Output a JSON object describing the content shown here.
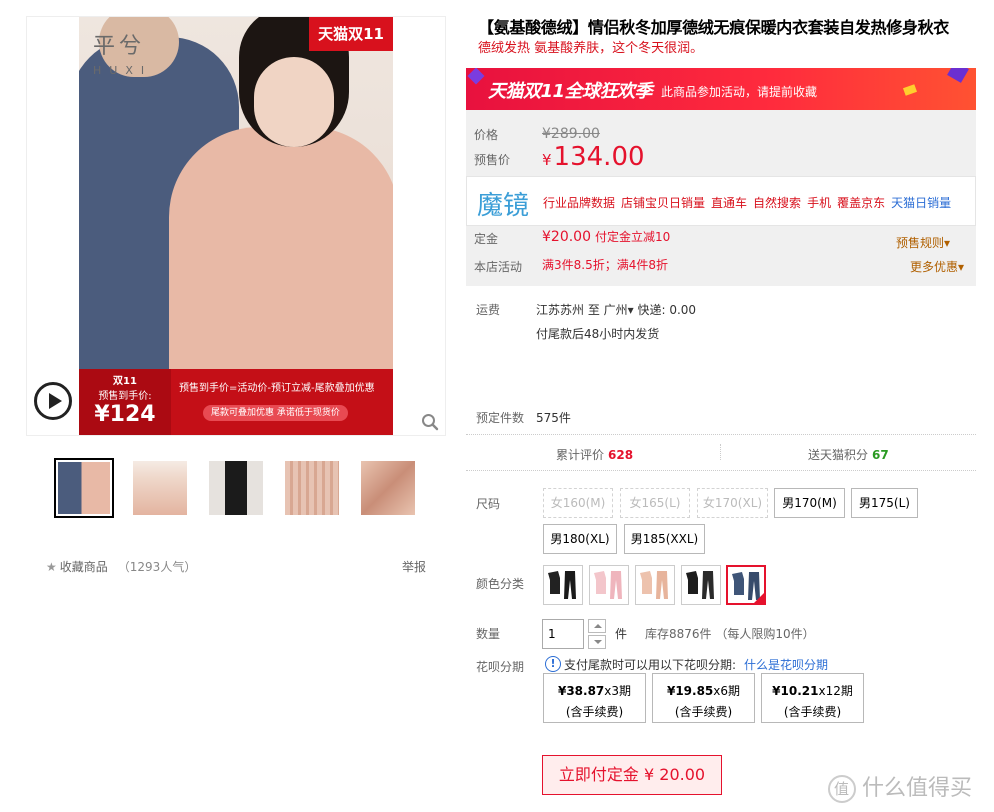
{
  "gallery": {
    "brand_logo": "平兮",
    "brand_logo_sub": "HUXI",
    "tmall_badge": "天猫双11",
    "promo": {
      "tag": "双11",
      "tag_sub": "预售到手价:",
      "price": "¥124",
      "text": "预售到手价=活动价-预订立减-尾款叠加优惠",
      "pill": "尾款可叠加优惠 承诺低于现货价"
    },
    "play_icon": "play-icon",
    "zoom_icon": "magnifier-icon",
    "thumbnails": [
      {
        "id": "thumb-1",
        "colors": [
          "#4b5c7d",
          "#e8b9a6"
        ],
        "active": true
      },
      {
        "id": "thumb-2",
        "colors": [
          "#efd8cb",
          "#e3b4a0"
        ],
        "active": false
      },
      {
        "id": "thumb-3",
        "colors": [
          "#e6e2de",
          "#1b1b1b"
        ],
        "active": false
      },
      {
        "id": "thumb-4",
        "colors": [
          "#e7c3b3",
          "#d8a792"
        ],
        "active": false
      },
      {
        "id": "thumb-5",
        "colors": [
          "#e9c4b0",
          "#c98e78"
        ],
        "active": false
      }
    ],
    "fav_label": "收藏商品",
    "fav_count": "（1293人气）",
    "report_label": "举报"
  },
  "product": {
    "title": "【氨基酸德绒】情侣秋冬加厚德绒无痕保暖内衣套装自发热修身秋衣",
    "subtitle": "德绒发热 氨基酸养肤，这个冬天很润。"
  },
  "banner": {
    "main": "天猫双11全球狂欢季",
    "sub": "此商品参加活动，请提前收藏"
  },
  "price_box": {
    "price_label": "价格",
    "orig_price": "¥289.00",
    "presale_label": "预售价",
    "currency": "¥",
    "presale_price": "134.00",
    "deposit_label": "定金",
    "deposit": "¥20.00",
    "deposit_note": "付定金立减10",
    "activity_label": "本店活动",
    "activity": "满3件8.5折；满4件8折",
    "rule_link": "预售规则",
    "more_link": "更多优惠"
  },
  "mojing": {
    "logo": "魔镜",
    "links": [
      "行业品牌数据",
      "店铺宝贝日销量",
      "直通车",
      "自然搜索",
      "手机",
      "覆盖京东"
    ],
    "link_blue": "天猫日销量"
  },
  "shipping": {
    "label": "运费",
    "line1": "江苏苏州  至  广州",
    "line1_rest": "  快递: 0.00",
    "line2": "付尾款后48小时内发货"
  },
  "reserved": {
    "label": "预定件数",
    "value": "575件"
  },
  "stats": {
    "reviews_label": "累计评价",
    "reviews": "628",
    "points_label": "送天猫积分",
    "points": "67"
  },
  "size": {
    "label": "尺码",
    "options": [
      {
        "label": "女160(M)",
        "disabled": true
      },
      {
        "label": "女165(L)",
        "disabled": true
      },
      {
        "label": "女170(XL)",
        "disabled": true
      },
      {
        "label": "男170(M)",
        "disabled": false
      },
      {
        "label": "男175(L)",
        "disabled": false
      },
      {
        "label": "男180(XL)",
        "disabled": false
      },
      {
        "label": "男185(XXL)",
        "disabled": false
      }
    ]
  },
  "color": {
    "label": "颜色分类",
    "swatches": [
      {
        "name": "black-set",
        "top": "#222222",
        "bottom": "#1a1a1a"
      },
      {
        "name": "pink-set",
        "top": "#f3c6cb",
        "bottom": "#efb5bd"
      },
      {
        "name": "nude-set",
        "top": "#edc2ad",
        "bottom": "#e7b49c"
      },
      {
        "name": "black-set-2",
        "top": "#1d1d1d",
        "bottom": "#2a2a2a"
      },
      {
        "name": "navy-set",
        "top": "#3f5578",
        "bottom": "#374b6b",
        "selected": true
      }
    ]
  },
  "quantity": {
    "label": "数量",
    "value": "1",
    "unit": "件",
    "stock": "库存8876件 （每人限购10件）"
  },
  "huabei": {
    "label": "花呗分期",
    "info_icon": "info-icon",
    "note": "支付尾款时可以用以下花呗分期:",
    "link": "什么是花呗分期",
    "options": [
      {
        "amount": "¥38.87",
        "period": "x3期",
        "fee": "(含手续费)"
      },
      {
        "amount": "¥19.85",
        "period": "x6期",
        "fee": "(含手续费)"
      },
      {
        "amount": "¥10.21",
        "period": "x12期",
        "fee": "(含手续费)"
      }
    ]
  },
  "pay_button": "立即付定金 ¥ 20.00",
  "watermark": "什么值得买",
  "colors": {
    "accent_red": "#e5122d",
    "tmall_red": "#d8111d",
    "link_blue": "#2c6ed5",
    "reviews_red": "#e5122d",
    "points_green": "#2a9a22"
  }
}
